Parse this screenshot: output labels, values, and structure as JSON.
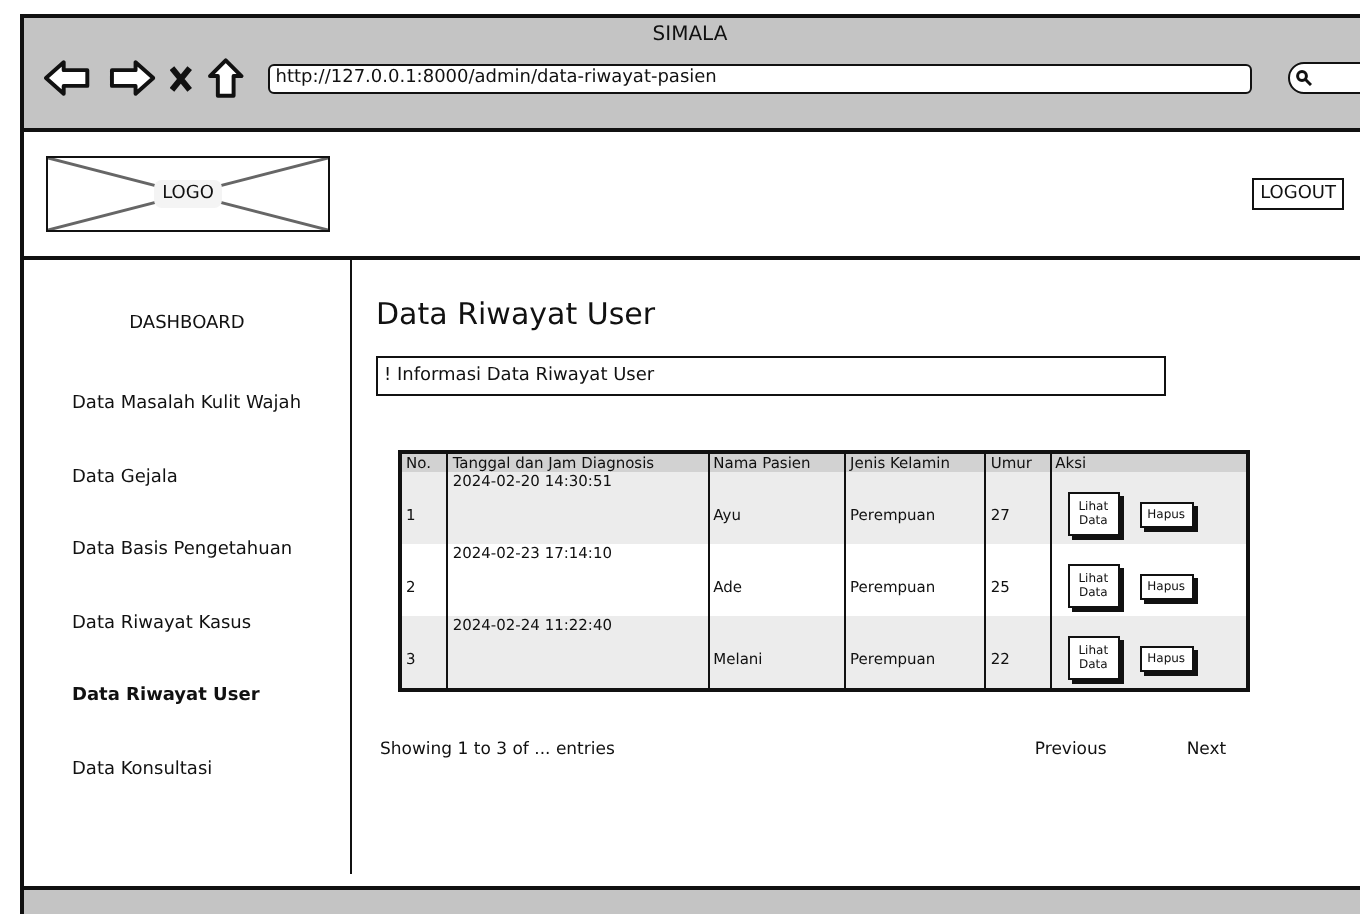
{
  "browser": {
    "title": "SIMALA",
    "url": "http://127.0.0.1:8000/admin/data-riwayat-pasien"
  },
  "header": {
    "logo": "LOGO",
    "logout": "LOGOUT"
  },
  "sidebar": {
    "items": [
      {
        "label": "DASHBOARD",
        "selected": false
      },
      {
        "label": "Data Masalah Kulit Wajah",
        "selected": false
      },
      {
        "label": "Data Gejala",
        "selected": false
      },
      {
        "label": "Data Basis Pengetahuan",
        "selected": false
      },
      {
        "label": "Data Riwayat Kasus",
        "selected": false
      },
      {
        "label": "Data Riwayat User",
        "selected": true
      },
      {
        "label": "Data Konsultasi",
        "selected": false
      }
    ]
  },
  "main": {
    "title": "Data Riwayat User",
    "info": "! Informasi Data Riwayat User",
    "table": {
      "columns": [
        "No.",
        "Tanggal dan Jam Diagnosis",
        "Nama Pasien",
        "Jenis Kelamin",
        "Umur",
        "Aksi"
      ],
      "rows": [
        {
          "cells": [
            "1",
            "2024-02-20 14:30:51",
            "Ayu",
            "Perempuan",
            "27"
          ],
          "actions": [
            "Lihat Data",
            "Hapus"
          ]
        },
        {
          "cells": [
            "2",
            "2024-02-23 17:14:10",
            "Ade",
            "Perempuan",
            "25"
          ],
          "actions": [
            "Lihat Data",
            "Hapus"
          ]
        },
        {
          "cells": [
            "3",
            "2024-02-24 11:22:40",
            "Melani",
            "Perempuan",
            "22"
          ],
          "actions": [
            "Lihat Data",
            "Hapus"
          ]
        }
      ]
    },
    "footer": {
      "info": "Showing 1 to 3 of ... entries",
      "previous": "Previous",
      "next": "Next"
    }
  }
}
